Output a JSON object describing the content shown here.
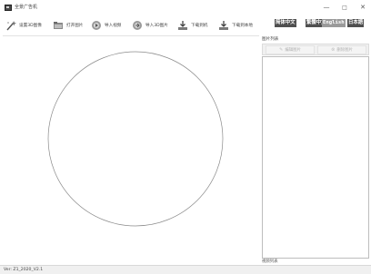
{
  "window": {
    "title": "全景广告机",
    "minimize": "—",
    "maximize": "□",
    "close": "✕"
  },
  "toolbar": {
    "items": [
      {
        "label": "设置3D图像",
        "icon": "wand-icon"
      },
      {
        "label": "打开图片",
        "icon": "folder-open-icon"
      },
      {
        "label": "导入视频",
        "icon": "import-video-icon"
      },
      {
        "label": "导入3D图片",
        "icon": "import-3d-image-icon"
      },
      {
        "label": "下载到机",
        "icon": "download-device-icon"
      },
      {
        "label": "下载到本地",
        "icon": "download-local-icon"
      }
    ]
  },
  "languages": {
    "simplified": "简体中文",
    "traditional": "繁體中文",
    "english": "English",
    "japanese": "日本語",
    "selected": "English"
  },
  "panel": {
    "header": "图片列表",
    "edit_label": "编辑图片",
    "delete_label": "删除图片",
    "footer": "视频列表"
  },
  "status": {
    "version": "Ver: Z1_2020_V2.1"
  },
  "colors": {
    "circle_stroke": "#8a8a8a",
    "lang_active": "#9a9a9a",
    "lang_inactive": "#4f4f4f"
  }
}
